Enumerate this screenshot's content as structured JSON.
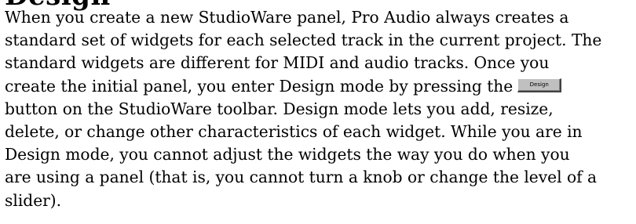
{
  "heading_fragment": "Design",
  "paragraph": {
    "lines": [
      "When you create a new StudioWare panel, Pro Audio always creates a",
      "standard set of widgets for each selected track in the current project. The",
      "standard widgets are different for MIDI and audio tracks. Once you",
      "create the initial panel, you enter Design mode by pressing the",
      "button on the StudioWare toolbar. Design mode lets you add, resize,",
      "delete, or change other characteristics of each widget. While you are in",
      "Design mode, you cannot adjust the widgets the way you do when you",
      "are using a panel (that is, you cannot turn a knob or change the level of a",
      "slider)."
    ]
  },
  "design_button": {
    "label": "Design",
    "icon": "design-button-icon"
  }
}
